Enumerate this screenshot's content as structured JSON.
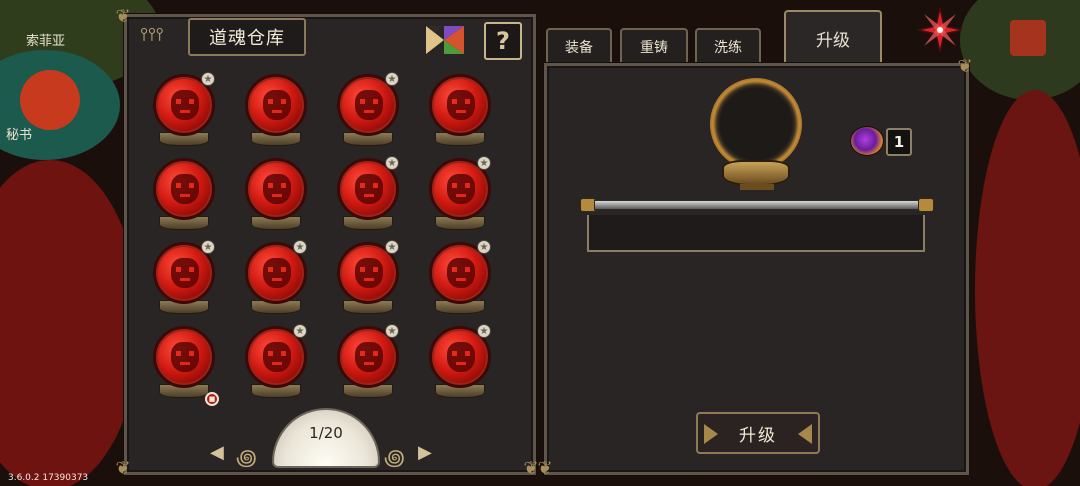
{
  "background": {
    "labels": [
      "索菲亚",
      "秘书"
    ]
  },
  "version": "3.6.0.2 17390373",
  "left_panel": {
    "title": "道魂仓库",
    "help_label": "?",
    "slots": [
      {
        "star": true,
        "lock": false
      },
      {
        "star": false,
        "lock": false
      },
      {
        "star": true,
        "lock": false
      },
      {
        "star": false,
        "lock": false
      },
      {
        "star": false,
        "lock": false
      },
      {
        "star": false,
        "lock": false
      },
      {
        "star": true,
        "lock": false
      },
      {
        "star": true,
        "lock": false
      },
      {
        "star": true,
        "lock": false
      },
      {
        "star": true,
        "lock": false
      },
      {
        "star": true,
        "lock": false
      },
      {
        "star": true,
        "lock": false
      },
      {
        "star": false,
        "lock": true
      },
      {
        "star": true,
        "lock": false
      },
      {
        "star": true,
        "lock": false
      },
      {
        "star": true,
        "lock": false
      }
    ],
    "pager": {
      "text": "1/20",
      "prev": "◀",
      "next": "▶"
    }
  },
  "tabs": [
    {
      "label": "装备",
      "active": false
    },
    {
      "label": "重铸",
      "active": false
    },
    {
      "label": "洗练",
      "active": false
    },
    {
      "label": "升级",
      "active": true
    }
  ],
  "right_panel": {
    "material_count": "1",
    "upgrade_button": "升级"
  },
  "colors": {
    "orb_red": "#d11a12",
    "frame_gold": "#a98e59",
    "panel_bg": "#2a2525"
  }
}
